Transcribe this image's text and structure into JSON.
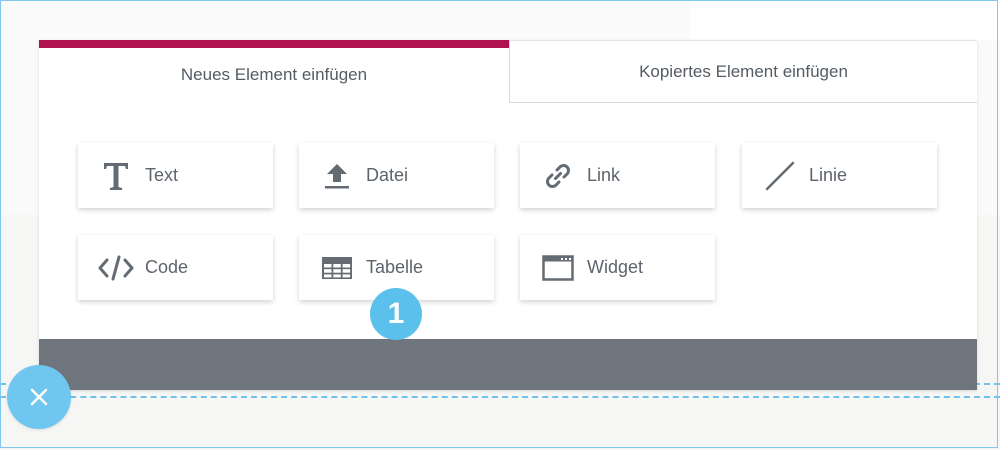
{
  "tabs": {
    "new_element": "Neues Element einfügen",
    "copied_element": "Kopiertes Element einfügen"
  },
  "elements": [
    {
      "label": "Text",
      "icon": "text-icon"
    },
    {
      "label": "Datei",
      "icon": "upload-icon"
    },
    {
      "label": "Link",
      "icon": "link-icon"
    },
    {
      "label": "Linie",
      "icon": "line-icon"
    },
    {
      "label": "Code",
      "icon": "code-icon"
    },
    {
      "label": "Tabelle",
      "icon": "table-icon"
    },
    {
      "label": "Widget",
      "icon": "widget-icon"
    }
  ],
  "badge": {
    "number": "1"
  },
  "colors": {
    "accent": "#b0124f",
    "badge": "#5bc0ec",
    "footer": "#6f757c",
    "close_button": "#6fc6ee"
  }
}
